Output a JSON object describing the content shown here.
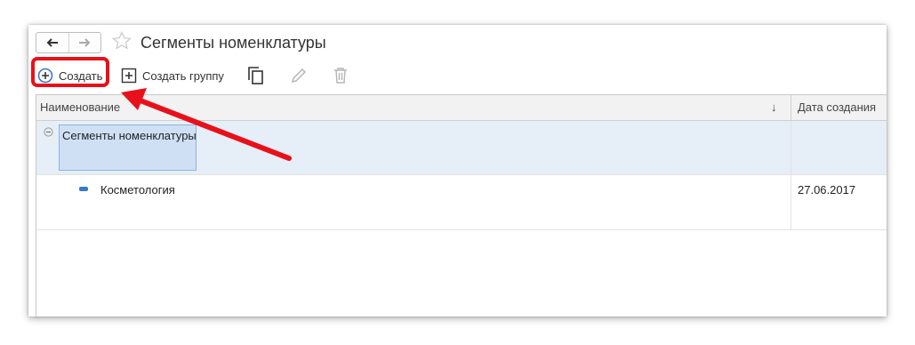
{
  "window": {
    "title": "Сегменты номенклатуры"
  },
  "toolbar": {
    "create_label": "Создать",
    "create_group_label": "Создать группу"
  },
  "table": {
    "columns": [
      "Наименование",
      "Дата создания"
    ],
    "sort_indicator": "↓",
    "rows": [
      {
        "name": "Сегменты номенклатуры",
        "date": "",
        "type": "group",
        "selected": true
      },
      {
        "name": "Косметология",
        "date": "27.06.2017",
        "type": "item",
        "selected": false
      }
    ]
  },
  "colors": {
    "annotation_red": "#e8101a",
    "selection_bg": "#e6eef7",
    "selected_cell": "#cfe0f5",
    "accent_blue": "#3a78c8"
  },
  "icons": [
    "back-arrow-icon",
    "forward-arrow-icon",
    "favorite-star-icon",
    "add-circle-icon",
    "add-square-icon",
    "copy-icon",
    "edit-pencil-icon",
    "delete-trash-icon",
    "collapse-icon",
    "item-icon"
  ]
}
